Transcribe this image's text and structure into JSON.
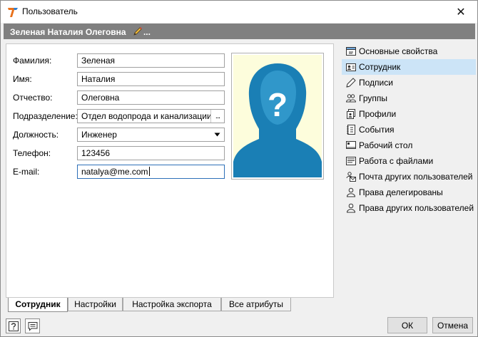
{
  "window": {
    "title": "Пользователь",
    "close_symbol": "✕"
  },
  "header": {
    "user_name": "Зеленая Наталия Олеговна",
    "edit_suffix": "..."
  },
  "form": {
    "fields": [
      {
        "label": "Фамилия:",
        "value": "Зеленая"
      },
      {
        "label": "Имя:",
        "value": "Наталия"
      },
      {
        "label": "Отчество:",
        "value": "Олеговна"
      },
      {
        "label": "Подразделение:",
        "value": "Отдел водопрода и канализации",
        "button": "..."
      },
      {
        "label": "Должность:",
        "value": "Инженер"
      },
      {
        "label": "Телефон:",
        "value": "123456"
      },
      {
        "label": "E-mail:",
        "value": "natalya@me.com"
      }
    ],
    "photo_symbol": "?"
  },
  "tabs": [
    {
      "label": "Сотрудник",
      "active": true
    },
    {
      "label": "Настройки"
    },
    {
      "label": "Настройка экспорта"
    },
    {
      "label": "Все атрибуты"
    }
  ],
  "sidebar": {
    "items": [
      {
        "label": "Основные свойства",
        "icon": "properties-icon"
      },
      {
        "label": "Сотрудник",
        "icon": "employee-card-icon",
        "selected": true
      },
      {
        "label": "Подписи",
        "icon": "signature-pen-icon"
      },
      {
        "label": "Группы",
        "icon": "groups-icon"
      },
      {
        "label": "Профили",
        "icon": "profiles-icon"
      },
      {
        "label": "События",
        "icon": "events-icon"
      },
      {
        "label": "Рабочий стол",
        "icon": "desktop-icon"
      },
      {
        "label": "Работа с файлами",
        "icon": "files-icon"
      },
      {
        "label": "Почта других пользователей",
        "icon": "mail-icon"
      },
      {
        "label": "Права делегированы",
        "icon": "user-rights-icon"
      },
      {
        "label": "Права других пользователей",
        "icon": "user-rights-icon"
      }
    ]
  },
  "footer": {
    "ok_label": "ОК",
    "cancel_label": "Отмена"
  }
}
